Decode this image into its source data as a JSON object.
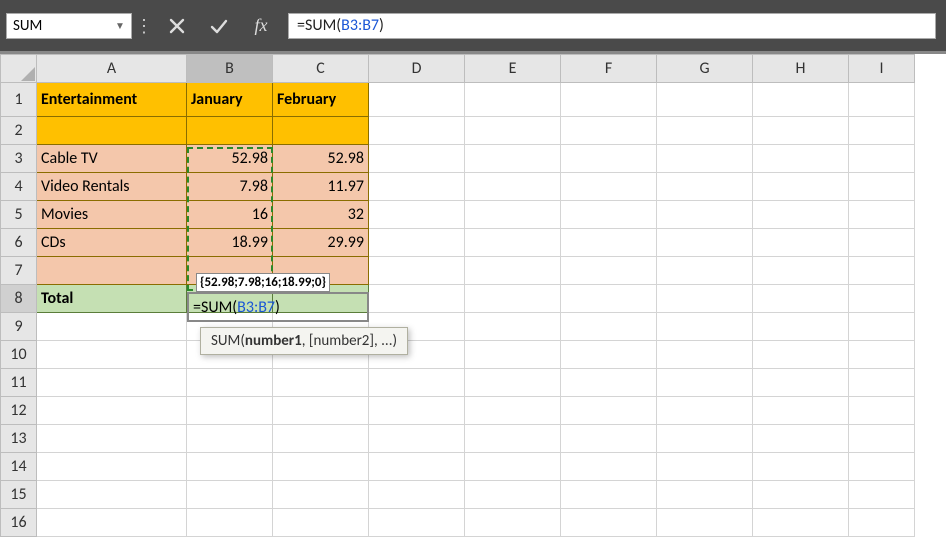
{
  "toolbar": {
    "namebox_value": "SUM",
    "cancel_icon": "✕",
    "accept_icon": "✓",
    "fx_label": "fx",
    "formula_prefix": "=SUM(",
    "formula_ref": "B3:B7",
    "formula_suffix": ")"
  },
  "columns": [
    "A",
    "B",
    "C",
    "D",
    "E",
    "F",
    "G",
    "H",
    "I"
  ],
  "row_numbers": [
    "1",
    "2",
    "3",
    "4",
    "5",
    "6",
    "7",
    "8",
    "9",
    "10",
    "11",
    "12",
    "13",
    "14",
    "15",
    "16"
  ],
  "headers": {
    "A1": "Entertainment",
    "B1": "January",
    "C1": "February"
  },
  "rows": [
    {
      "label": "Cable TV",
      "jan": "52.98",
      "feb": "52.98"
    },
    {
      "label": "Video Rentals",
      "jan": "7.98",
      "feb": "11.97"
    },
    {
      "label": "Movies",
      "jan": "16",
      "feb": "32"
    },
    {
      "label": "CDs",
      "jan": "18.99",
      "feb": "29.99"
    }
  ],
  "total_label": "Total",
  "edit_cell": {
    "prefix": "=SUM(",
    "ref": "B3:B7",
    "suffix": ")"
  },
  "array_tooltip": "{52.98;7.98;16;18.99;0}",
  "fn_hint": {
    "name": "SUM",
    "arg1": "number1",
    "rest": ", [number2], ...)"
  },
  "chart_data": {
    "type": "table",
    "columns": [
      "Entertainment",
      "January",
      "February"
    ],
    "rows": [
      [
        "Cable TV",
        52.98,
        52.98
      ],
      [
        "Video Rentals",
        7.98,
        11.97
      ],
      [
        "Movies",
        16,
        32
      ],
      [
        "CDs",
        18.99,
        29.99
      ]
    ],
    "formula": "=SUM(B3:B7)"
  }
}
